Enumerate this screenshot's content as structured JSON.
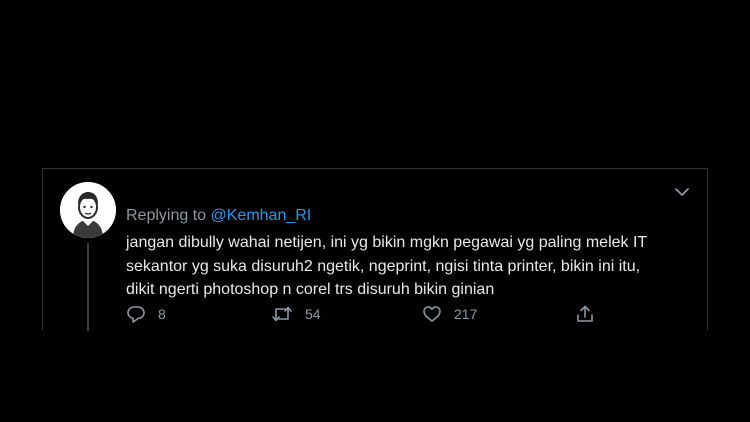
{
  "tweet": {
    "replying_prefix": "Replying to ",
    "replying_handle": "@Kemhan_RI",
    "text_lines": [
      "jangan dibully wahai netijen, ini yg bikin mgkn pegawai yg paling melek IT",
      "sekantor yg suka disuruh2 ngetik, ngeprint, ngisi tinta printer, bikin ini itu,",
      "dikit ngerti photoshop n corel trs disuruh bikin ginian"
    ],
    "actions": {
      "reply_count": "8",
      "retweet_count": "54",
      "like_count": "217"
    }
  },
  "icons": {
    "avatar": "default-avatar-icon",
    "menu": "chevron-down-icon",
    "reply": "reply-icon",
    "retweet": "retweet-icon",
    "like": "heart-icon",
    "share": "share-icon"
  },
  "colors": {
    "background": "#000000",
    "text": "#e7e9ea",
    "muted": "#8b98a5",
    "link": "#1d9bf0",
    "border": "#2f3336"
  }
}
